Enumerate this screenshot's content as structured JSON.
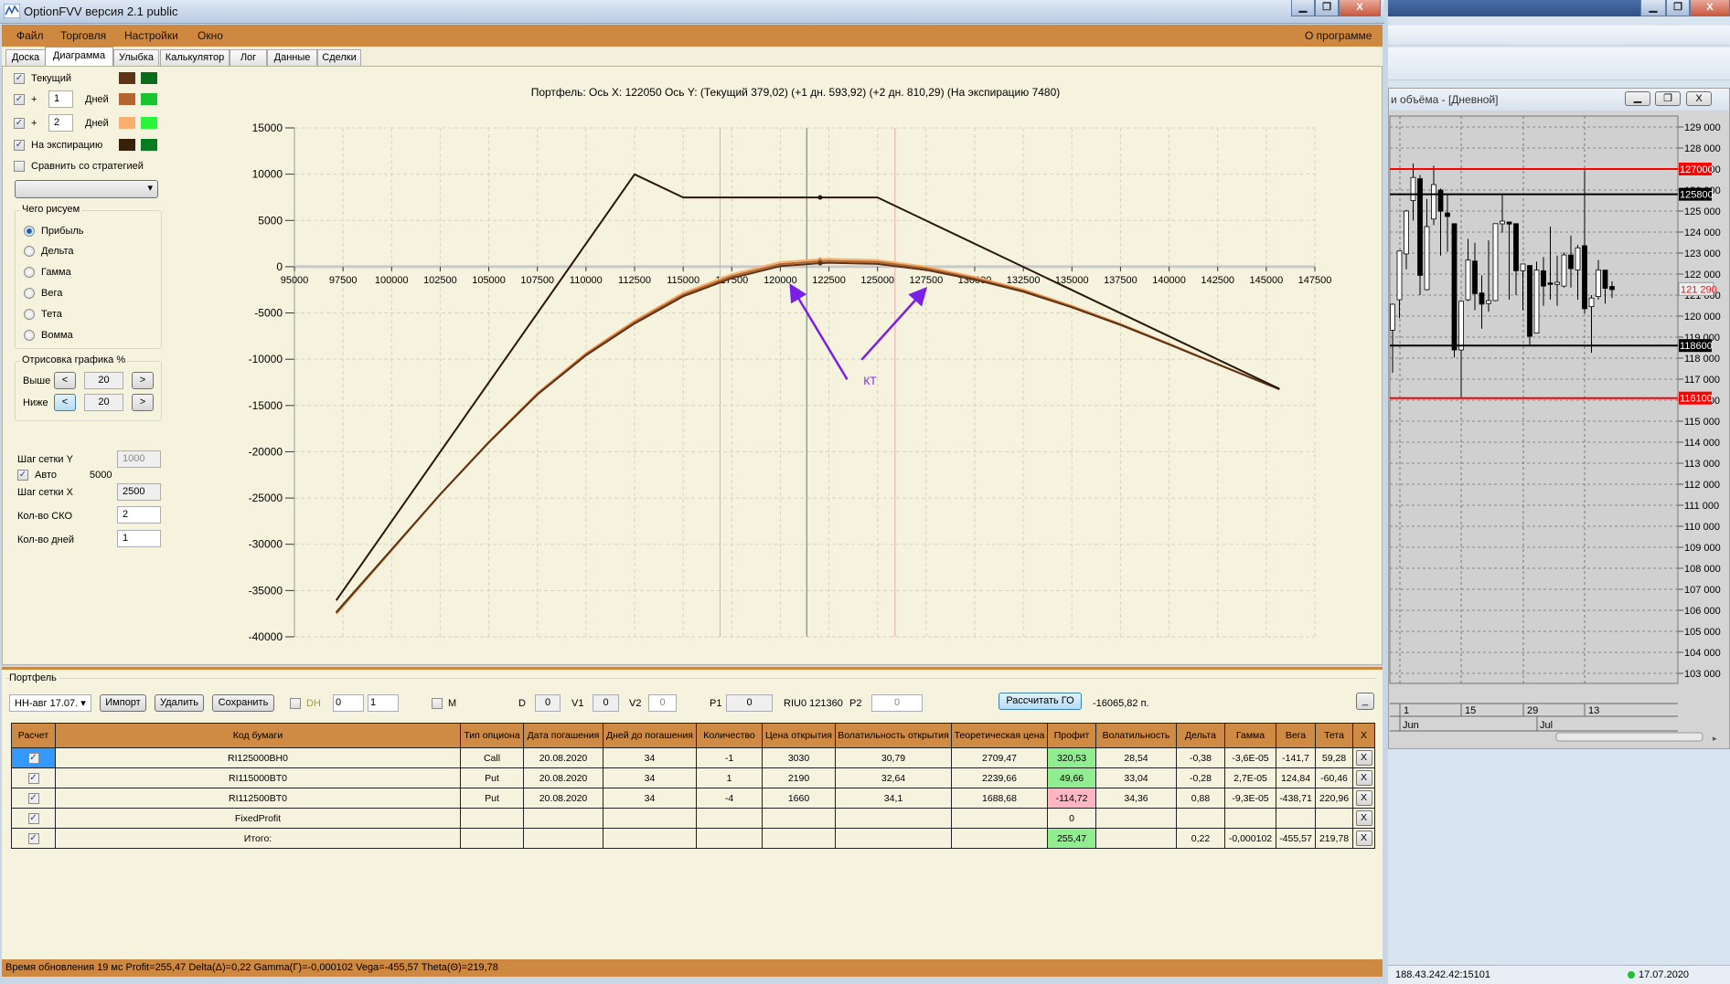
{
  "app": {
    "title": "OptionFVV версия 2.1 public",
    "min": "▁",
    "max": "❐",
    "close": "X"
  },
  "menu": {
    "file": "Файл",
    "trade": "Торговля",
    "settings": "Настройки",
    "window": "Окно",
    "about": "О программе"
  },
  "tabs": [
    "Доска",
    "Диаграмма",
    "Улыбка",
    "Калькулятор",
    "Лог",
    "Данные",
    "Сделки"
  ],
  "left": {
    "current_label": "Текущий",
    "plus": "+",
    "days_label": "Дней",
    "day1": "1",
    "day2": "2",
    "expiry_label": "На экспирацию",
    "compare_label": "Сравнить со стратегией",
    "colors": {
      "current": [
        "#5c3317",
        "#0a6b1a"
      ],
      "day1": [
        "#b5652f",
        "#19c42e"
      ],
      "day2": [
        "#f8b070",
        "#2af53a"
      ],
      "expiry": [
        "#3a1f0a",
        "#0a7a1e"
      ]
    },
    "draw_group": "Чего рисуем",
    "radios": [
      "Прибыль",
      "Дельта",
      "Гамма",
      "Вега",
      "Тета",
      "Вомма"
    ],
    "render_group": "Отрисовка графика %",
    "above": "Выше",
    "below": "Ниже",
    "above_val": "20",
    "below_val": "20",
    "lt": "<",
    "gt": ">",
    "grid_y_label": "Шаг сетки Y",
    "grid_y": "1000",
    "auto_label": "Авто",
    "auto_val": "5000",
    "grid_x_label": "Шаг сетки X",
    "grid_x": "2500",
    "sko_label": "Кол-во СКО",
    "sko": "2",
    "days_count_label": "Кол-во дней",
    "days_count": "1"
  },
  "chart_data": {
    "type": "line",
    "title": "Портфель: Ось X: 122050 Ось Y:  (Текущий 379,02)  (+1 дн. 593,92)  (+2 дн. 810,29)  (На экспирацию 7480)",
    "xlim": [
      95000,
      147500
    ],
    "ylim": [
      -40000,
      15000
    ],
    "xticks": [
      95000,
      97500,
      100000,
      102500,
      105000,
      107500,
      110000,
      112500,
      115000,
      117500,
      120000,
      122500,
      125000,
      127500,
      130000,
      132500,
      135000,
      137500,
      140000,
      142500,
      145000,
      147500
    ],
    "yticks": [
      15000,
      10000,
      5000,
      0,
      -5000,
      -10000,
      -15000,
      -20000,
      -25000,
      -30000,
      -35000,
      -40000
    ],
    "grid": true,
    "cursor_x": 122050,
    "price_line": 121360,
    "sigma_lines": [
      116900,
      125900
    ],
    "x": [
      97150,
      100000,
      102500,
      105000,
      107500,
      110000,
      112500,
      115000,
      117500,
      120000,
      122050,
      122500,
      125000,
      127500,
      130000,
      132500,
      135000,
      137500,
      140000,
      142500,
      145680
    ],
    "series": [
      {
        "name": "На экспирацию",
        "color": "#2a160a",
        "x": [
          97150,
          112500,
          115000,
          125000,
          145680
        ],
        "values": [
          -36070,
          9980,
          7480,
          7480,
          -13200
        ]
      },
      {
        "name": "Текущий",
        "color": "#5c3317",
        "values": [
          -37350,
          -30560,
          -24600,
          -19000,
          -13820,
          -9575,
          -6140,
          -3200,
          -1240,
          65,
          379,
          420,
          300,
          -350,
          -1400,
          -2700,
          -4400,
          -6300,
          -8400,
          -10550,
          -13250
        ]
      },
      {
        "name": "+1 дн.",
        "color": "#b5652f",
        "values": [
          -37450,
          -30610,
          -24600,
          -18960,
          -13740,
          -9455,
          -5980,
          -3010,
          -1030,
          280,
          594,
          635,
          505,
          -170,
          -1250,
          -2580,
          -4310,
          -6240,
          -8360,
          -10530,
          -13250
        ]
      },
      {
        "name": "+2 дн.",
        "color": "#f8b070",
        "values": [
          -37550,
          -30660,
          -24600,
          -18920,
          -13660,
          -9335,
          -5820,
          -2820,
          -820,
          495,
          810,
          850,
          710,
          10,
          -1100,
          -2460,
          -4220,
          -6180,
          -8320,
          -10510,
          -13250
        ]
      }
    ],
    "annotation": {
      "text": "КТ",
      "color": "#7a1fe8",
      "arrows": [
        [
          123440,
          -12190,
          120590,
          -2220
        ],
        [
          124180,
          -10065,
          127400,
          -2550
        ]
      ],
      "label_at": [
        124280,
        -12350
      ]
    }
  },
  "portfolio": {
    "title": "Портфель",
    "select": "НН-авг 17.07.",
    "import": "Импорт",
    "delete": "Удалить",
    "save": "Сохранить",
    "dh": "DH",
    "spin1": "0",
    "spin2": "1",
    "m": "M",
    "d_label": "D",
    "d": "0",
    "v1_label": "V1",
    "v1": "0",
    "v2_label": "V2",
    "v2": "0",
    "p1_label": "P1",
    "p1": "0",
    "riu": "RIU0 121360",
    "p2_label": "P2",
    "p2": "0",
    "calc_go": "Рассчитать ГО",
    "go_value": "-16065,82 п.",
    "minimize": "_",
    "headers": [
      "Расчет",
      "Код бумаги",
      "Тип опциона",
      "Дата погашения",
      "Дней до погашения",
      "Количество",
      "Цена открытия",
      "Волатильность открытия",
      "Теоретическая цена",
      "Профит",
      "Волатильность",
      "Дельта",
      "Гамма",
      "Вега",
      "Тета",
      "X"
    ],
    "rows": [
      {
        "code": "RI125000BH0",
        "type": "Call",
        "date": "20.08.2020",
        "days": "34",
        "qty": "-1",
        "open": "3030",
        "vol_open": "30,79",
        "theo": "2709,47",
        "profit": "320,53",
        "vol": "28,54",
        "delta": "-0,38",
        "gamma": "-3,6E-05",
        "vega": "-141,7",
        "theta": "59,28",
        "pstate": "pos"
      },
      {
        "code": "RI115000BT0",
        "type": "Put",
        "date": "20.08.2020",
        "days": "34",
        "qty": "1",
        "open": "2190",
        "vol_open": "32,64",
        "theo": "2239,66",
        "profit": "49,66",
        "vol": "33,04",
        "delta": "-0,28",
        "gamma": "2,7E-05",
        "vega": "124,84",
        "theta": "-60,46",
        "pstate": "pos"
      },
      {
        "code": "RI112500BT0",
        "type": "Put",
        "date": "20.08.2020",
        "days": "34",
        "qty": "-4",
        "open": "1660",
        "vol_open": "34,1",
        "theo": "1688,68",
        "profit": "-114,72",
        "vol": "34,36",
        "delta": "0,88",
        "gamma": "-9,3E-05",
        "vega": "-438,71",
        "theta": "220,96",
        "pstate": "neg"
      },
      {
        "code": "FixedProfit",
        "type": "",
        "date": "",
        "days": "",
        "qty": "",
        "open": "",
        "vol_open": "",
        "theo": "",
        "profit": "0",
        "vol": "",
        "delta": "",
        "gamma": "",
        "vega": "",
        "theta": "",
        "pstate": ""
      },
      {
        "code": "Итого:",
        "type": "",
        "date": "",
        "days": "",
        "qty": "",
        "open": "",
        "vol_open": "",
        "theo": "",
        "profit": "255,47",
        "vol": "",
        "delta": "0,22",
        "gamma": "-0,000102",
        "vega": "-455,57",
        "theta": "219,78",
        "pstate": "pos"
      }
    ],
    "check": "✓",
    "x": "X"
  },
  "status": "Время обновления 19 мс  Profit=255,47 Delta(Δ)=0,22 Gamma(Γ)=-0,000102 Vega=-455,57 Theta(Θ)=219,78",
  "price_chart": {
    "title": "и объёма - [Дневной]",
    "yticks": [
      129000,
      128000,
      127000,
      126000,
      125000,
      124000,
      123000,
      122000,
      121000,
      120000,
      119000,
      118000,
      117000,
      116000,
      115000,
      114000,
      113000,
      112000,
      111000,
      110000,
      109000,
      108000,
      107000,
      106000,
      105000,
      104000,
      103000
    ],
    "ylim": [
      102700,
      129600
    ],
    "levels": [
      {
        "value": 127000,
        "label": "127000",
        "color": "#ff0000"
      },
      {
        "value": 125800,
        "label": "125800",
        "color": "#000000"
      },
      {
        "value": 118600,
        "label": "118600",
        "color": "#000000"
      },
      {
        "value": 116100,
        "label": "116100",
        "color": "#ff0000"
      }
    ],
    "last_price": "121 290",
    "last_value": 121290,
    "days": [
      "1",
      "15",
      "29",
      "13"
    ],
    "months": [
      "Jun",
      "Jul"
    ],
    "candles": [
      [
        119330,
        120600,
        117300,
        120565
      ],
      [
        120780,
        123100,
        119900,
        123100
      ],
      [
        122960,
        125060,
        122230,
        125000
      ],
      [
        125500,
        127260,
        124550,
        126600
      ],
      [
        126540,
        126720,
        121000,
        121940
      ],
      [
        121260,
        125570,
        121230,
        124260
      ],
      [
        124620,
        127160,
        124330,
        126260
      ],
      [
        126000,
        126070,
        122880,
        124990
      ],
      [
        124910,
        125780,
        123060,
        124740
      ],
      [
        124400,
        124400,
        118030,
        118390
      ],
      [
        118390,
        120710,
        116140,
        120710
      ],
      [
        120780,
        123680,
        120710,
        122670
      ],
      [
        122620,
        123490,
        120280,
        121070
      ],
      [
        121100,
        121940,
        119400,
        120570
      ],
      [
        120600,
        123610,
        120200,
        120740
      ],
      [
        120740,
        124400,
        120710,
        124400
      ],
      [
        124390,
        125780,
        123970,
        124520
      ],
      [
        124480,
        124480,
        120780,
        124380
      ],
      [
        124400,
        124400,
        121000,
        122160
      ],
      [
        122160,
        122480,
        120280,
        122480
      ],
      [
        122410,
        122410,
        118610,
        119040
      ],
      [
        119190,
        122590,
        119190,
        122190
      ],
      [
        122160,
        122810,
        120490,
        121430
      ],
      [
        121580,
        124260,
        120780,
        121510
      ],
      [
        121510,
        122880,
        120490,
        121610
      ],
      [
        121430,
        123030,
        121360,
        122910
      ],
      [
        122910,
        123830,
        121360,
        122260
      ],
      [
        122190,
        123390,
        120780,
        123250
      ],
      [
        123350,
        126940,
        120130,
        120350
      ],
      [
        120450,
        121000,
        118250,
        120860
      ],
      [
        120930,
        122670,
        120780,
        122200
      ],
      [
        122190,
        122190,
        120590,
        121320
      ],
      [
        121410,
        121650,
        120860,
        121260
      ]
    ]
  },
  "taskbar": {
    "ip": "188.43.242.42:15101",
    "date": "17.07.2020"
  }
}
